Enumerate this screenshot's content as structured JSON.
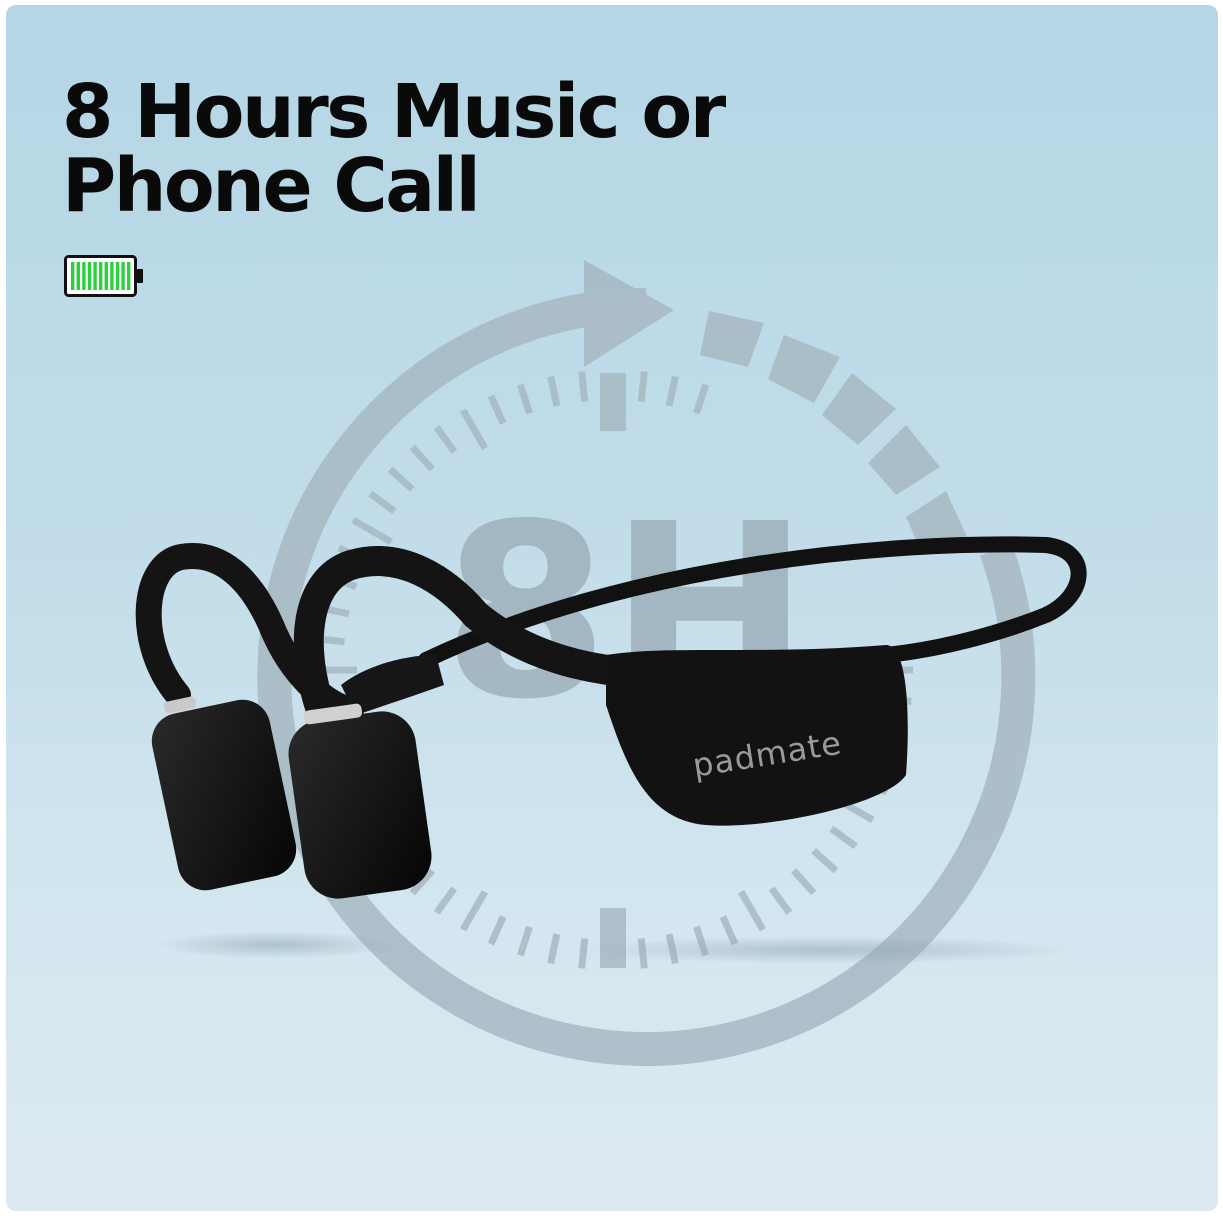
{
  "headline": {
    "line1": "8 Hours Music or",
    "line2": "Phone Call"
  },
  "badge": {
    "icon": "battery-full-icon",
    "level_percent": 100,
    "color": "#2bd13c"
  },
  "clock": {
    "icon": "clock-8-hours-icon",
    "label": "8H",
    "color": "#9fb3bf"
  },
  "product": {
    "brand": "padmate",
    "color": "#111111"
  }
}
